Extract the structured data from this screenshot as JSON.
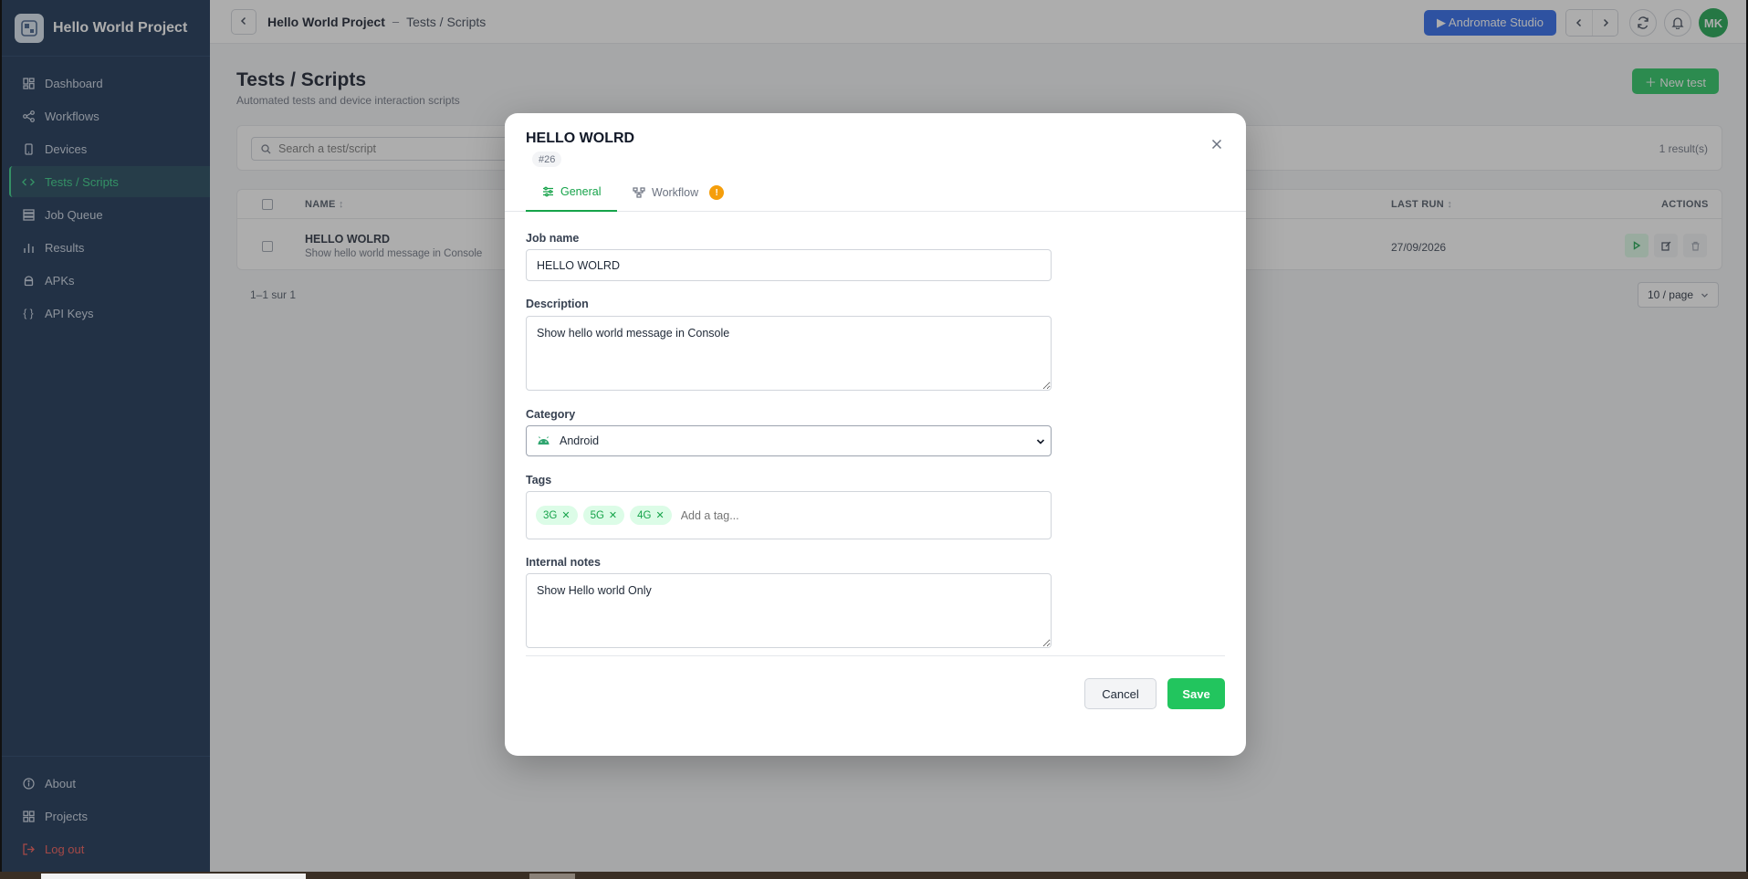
{
  "app": {
    "name": "Hello World Project"
  },
  "colors": {
    "sidebar_bg": "#102a4c",
    "accent_green": "#22c55e",
    "studio_blue": "#2563eb",
    "warning": "#f59e0b",
    "danger": "#ef5350"
  },
  "sidebar": {
    "items": [
      {
        "label": "Dashboard",
        "icon": "dashboard-icon"
      },
      {
        "label": "Workflows",
        "icon": "workflow-icon"
      },
      {
        "label": "Devices",
        "icon": "device-icon"
      },
      {
        "label": "Tests / Scripts",
        "icon": "code-icon",
        "active": true
      },
      {
        "label": "Job Queue",
        "icon": "queue-icon"
      },
      {
        "label": "Results",
        "icon": "bar-chart-icon"
      },
      {
        "label": "APKs",
        "icon": "android-icon"
      },
      {
        "label": "API Keys",
        "icon": "braces-icon"
      }
    ],
    "bottom": [
      {
        "label": "About",
        "icon": "info-icon"
      },
      {
        "label": "Projects",
        "icon": "grid-icon"
      },
      {
        "label": "Log out",
        "icon": "logout-icon"
      }
    ]
  },
  "topbar": {
    "project": "Hello World Project",
    "separator": "–",
    "page": "Tests / Scripts",
    "studio_label": "▶ Andromate Studio",
    "avatar_initials": "MK"
  },
  "page": {
    "title": "Tests / Scripts",
    "subtitle": "Automated tests and device interaction scripts",
    "new_button": "＋ New test",
    "search_placeholder": "Search a test/script",
    "result_count": "1 result(s)",
    "columns": {
      "name": "NAME",
      "last_run": "LAST RUN",
      "actions": "ACTIONS"
    },
    "rows": [
      {
        "name": "HELLO WOLRD",
        "description": "Show hello world message in Console",
        "last_run": "27/09/2026"
      }
    ],
    "pagination_text": "1–1 sur 1",
    "per_page": "10 / page"
  },
  "modal": {
    "title": "HELLO WOLRD",
    "id_badge": "#26",
    "tabs": {
      "general": "General",
      "workflow": "Workflow",
      "workflow_warning": "!"
    },
    "job_name": {
      "label": "Job name",
      "value": "HELLO WOLRD"
    },
    "description": {
      "label": "Description",
      "value": "Show hello world message in Console"
    },
    "category": {
      "label": "Category",
      "value": "Android"
    },
    "tags": {
      "label": "Tags",
      "items": [
        "3G",
        "5G",
        "4G"
      ],
      "placeholder": "Add a tag..."
    },
    "notes": {
      "label": "Internal notes",
      "value": "Show Hello world Only"
    },
    "cancel": "Cancel",
    "save": "Save"
  }
}
